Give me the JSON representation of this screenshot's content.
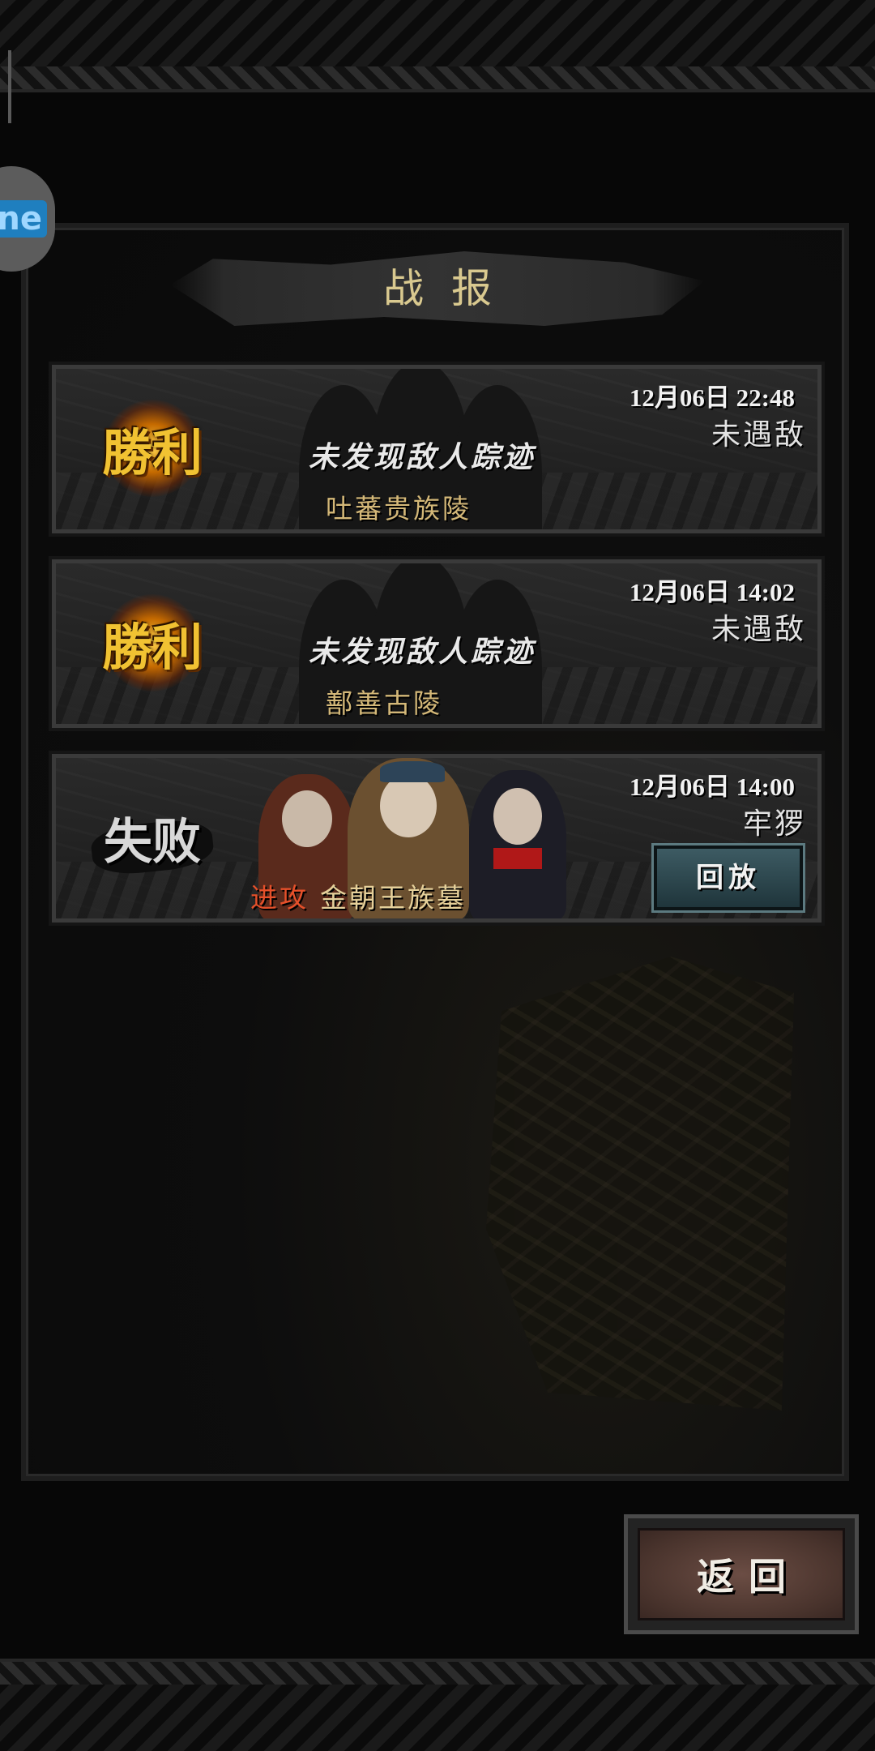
{
  "side_badge": {
    "label": "ne"
  },
  "title": "战报",
  "reports": [
    {
      "result": "勝利",
      "datetime": "12月06日 22:48",
      "enemy": "未遇敌",
      "message": "未发现敌人踪迹",
      "location": "吐蕃贵族陵"
    },
    {
      "result": "勝利",
      "datetime": "12月06日 14:02",
      "enemy": "未遇敌",
      "message": "未发现敌人踪迹",
      "location": "鄯善古陵"
    },
    {
      "result": "失败",
      "datetime": "12月06日 14:00",
      "enemy": "牢猡",
      "action": "进攻",
      "location": "金朝王族墓",
      "replay_label": "回放"
    }
  ],
  "return_label": "返回",
  "colors": {
    "title": "#d9c98f",
    "win_gold": "#f1c232",
    "attack_red": "#e5502a",
    "location_gold": "#d4b878"
  }
}
